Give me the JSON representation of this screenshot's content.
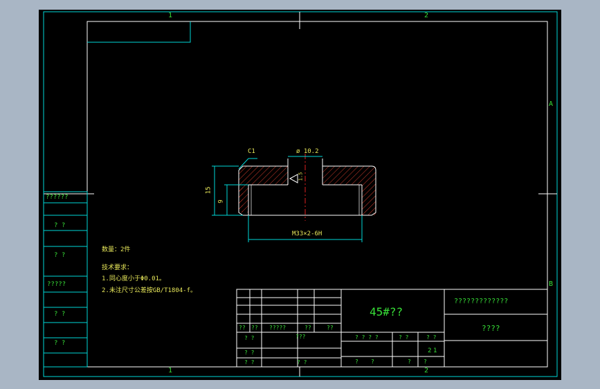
{
  "zones": {
    "top": [
      "1",
      "2"
    ],
    "bottom": [
      "1",
      "2"
    ],
    "right": [
      "A",
      "B"
    ]
  },
  "left_strip": [
    "??????",
    "? ?",
    "? ?",
    "?????",
    "? ?",
    "? ?"
  ],
  "drawing": {
    "chamfer": "C1",
    "top_dim": "ø 10.2",
    "height_dim": "15",
    "inner_height_dim": "9",
    "thread_dim": "M33×2-6H",
    "small_dim": "1.5"
  },
  "notes": {
    "quantity": "数量：2件",
    "heading": "技术要求：",
    "line1": "1.同心度小于Φ0.01。",
    "line2": "2.未注尺寸公差按GB/T1804-f。"
  },
  "title_block": {
    "material": "45#??",
    "drawing_name": "?????????????",
    "drawing_code": "????",
    "row_labels": [
      "??",
      "??",
      "?????",
      "??",
      "??"
    ],
    "left_lower": [
      "? ?",
      "???",
      "? ?",
      "? ?",
      "? ?"
    ],
    "mid_headers": [
      "? ? ? ?",
      "? ?",
      "? ?"
    ],
    "mid_values": [
      "2",
      "1"
    ],
    "mid_bottom": [
      "?",
      "?",
      "?",
      "?"
    ]
  },
  "colors": {
    "border": "#00d7d7",
    "line": "#ffffff",
    "text": "#38e038",
    "hatch": "#d23c2c",
    "center": "#e02020"
  }
}
